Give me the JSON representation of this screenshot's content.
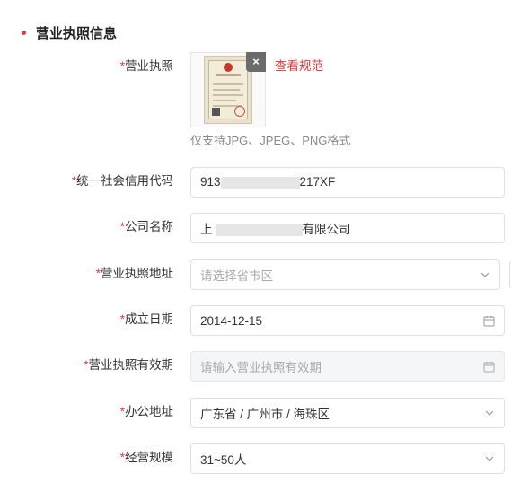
{
  "section": {
    "title": "营业执照信息"
  },
  "license": {
    "label": "营业执照",
    "view_link": "查看规范",
    "hint": "仅支持JPG、JPEG、PNG格式",
    "delete_label": "×"
  },
  "fields": {
    "credit_code": {
      "label": "统一社会信用代码",
      "value_prefix": "913",
      "value_suffix": "217XF"
    },
    "company_name": {
      "label": "公司名称",
      "value_prefix": "上",
      "value_suffix": "有限公司"
    },
    "license_address": {
      "label": "营业执照地址",
      "placeholder": "请选择省市区"
    },
    "established_date": {
      "label": "成立日期",
      "value": "2014-12-15"
    },
    "license_validity": {
      "label": "营业执照有效期",
      "placeholder": "请输入营业执照有效期"
    },
    "office_address": {
      "label": "办公地址",
      "value": "广东省 / 广州市 / 海珠区"
    },
    "business_scale": {
      "label": "经营规模",
      "value": "31~50人"
    }
  },
  "required_mark": "*",
  "colors": {
    "accent": "#e4393c",
    "hint": "#888888",
    "border": "#dcdfe6"
  }
}
